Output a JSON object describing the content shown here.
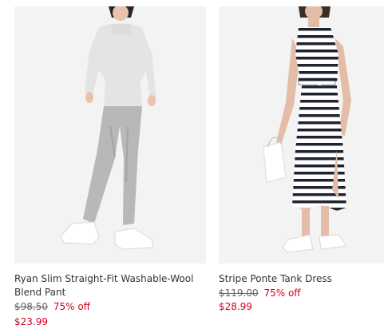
{
  "products": [
    {
      "image_alt": "model wearing light sweater and gray slim pants",
      "title": "Ryan Slim Straight-Fit Washable-Wool Blend Pant",
      "original_price": "$98.50",
      "discount": "75% off",
      "sale_price": "$23.99"
    },
    {
      "image_alt": "model wearing black and white striped tank dress",
      "title": "Stripe Ponte Tank Dress",
      "original_price": "$119.00",
      "discount": "75% off",
      "sale_price": "$28.99"
    }
  ],
  "colors": {
    "sale": "#d6001c",
    "text": "#333333",
    "strikethrough": "#666666",
    "image_bg": "#f3f3f3"
  }
}
